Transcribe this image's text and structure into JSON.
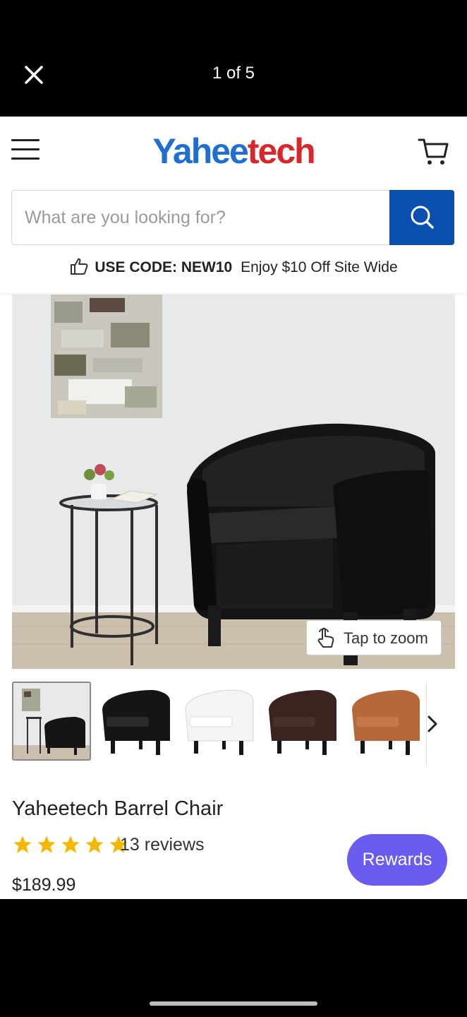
{
  "viewer": {
    "counter": "1 of 5",
    "close_icon": "close-icon"
  },
  "header": {
    "logo_part1": "Yahee",
    "logo_part2": "tech",
    "menu_icon": "hamburger-menu-icon",
    "cart_icon": "cart-icon"
  },
  "search": {
    "placeholder": "What are you looking for?",
    "button_icon": "search-icon"
  },
  "promo": {
    "icon": "thumbs-up-icon",
    "code": "USE CODE: NEW10",
    "text": "Enjoy $10 Off Site Wide"
  },
  "gallery": {
    "zoom_label": "Tap to zoom",
    "zoom_icon": "tap-hand-icon",
    "thumbnails": [
      "room-scene",
      "black",
      "white",
      "brown",
      "tan"
    ],
    "next_icon": "chevron-right-icon"
  },
  "product": {
    "title": "Yaheetech Barrel Chair",
    "rating": 5,
    "reviews": "13 reviews",
    "price": "$189.99"
  },
  "rewards": {
    "label": "Rewards"
  },
  "colors": {
    "brand_blue": "#1f6fd0",
    "brand_red": "#d9262b",
    "search_button": "#0a4fb0",
    "star": "#f5b800",
    "rewards": "#6a5cf0"
  }
}
